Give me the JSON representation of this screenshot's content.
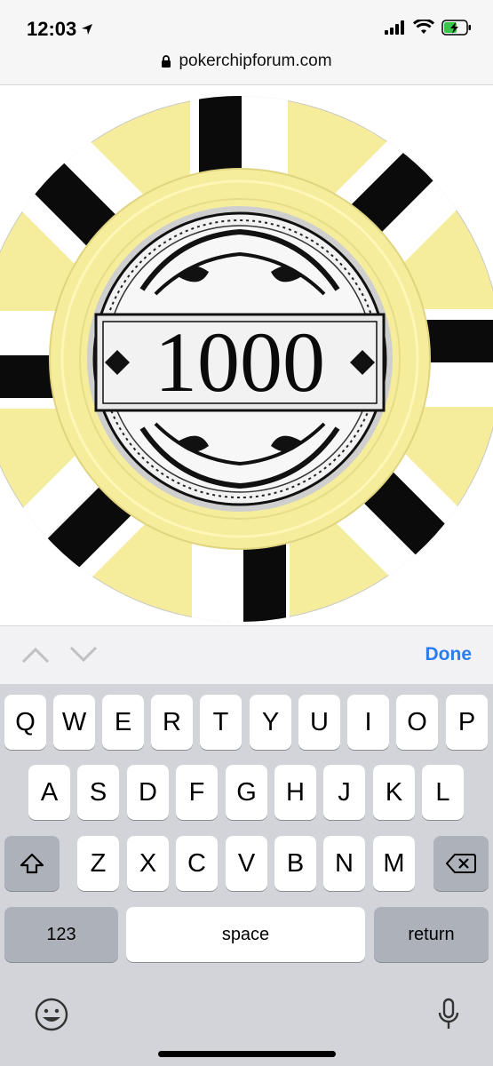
{
  "status": {
    "time": "12:03"
  },
  "browser": {
    "url": "pokerchipforum.com"
  },
  "chip": {
    "denomination": "1000",
    "colors": {
      "edge": "#f5ec9c",
      "stripe_black": "#0b0b0b",
      "stripe_white": "#ffffff",
      "inlay": "#d9d9d9"
    }
  },
  "accessory": {
    "done_label": "Done"
  },
  "keyboard": {
    "row1": [
      "Q",
      "W",
      "E",
      "R",
      "T",
      "Y",
      "U",
      "I",
      "O",
      "P"
    ],
    "row2": [
      "A",
      "S",
      "D",
      "F",
      "G",
      "H",
      "J",
      "K",
      "L"
    ],
    "row3": [
      "Z",
      "X",
      "C",
      "V",
      "B",
      "N",
      "M"
    ],
    "numbers_label": "123",
    "space_label": "space",
    "return_label": "return"
  }
}
